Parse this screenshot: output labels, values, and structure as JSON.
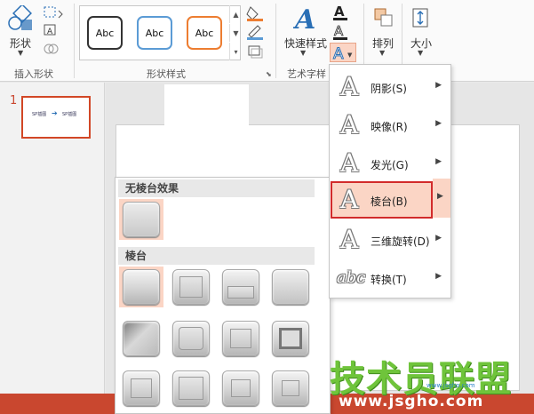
{
  "ribbon": {
    "insert_shapes": {
      "shape_label": "形状",
      "group_label": "插入形状"
    },
    "shape_styles": {
      "group_label": "形状样式",
      "styles": [
        "Abc",
        "Abc",
        "Abc"
      ]
    },
    "art_text": {
      "quick_styles_label": "快速样式",
      "group_label": "艺术字样"
    },
    "arrange": {
      "label": "排列"
    },
    "size": {
      "label": "大小"
    },
    "colors": {
      "black_border": "#333333",
      "blue_border": "#5b9bd5",
      "orange_border": "#ed7d31",
      "accent": "#d24726"
    }
  },
  "thumbnails": {
    "slide_number": "1",
    "slide_text_left": "SP插图",
    "slide_text_right": "SP插图"
  },
  "bevel_panel": {
    "no_bevel_header": "无棱台效果",
    "bevel_header": "棱台"
  },
  "effects_menu": {
    "items": [
      {
        "label": "阴影(S)",
        "icon": "text-effect-A-icon"
      },
      {
        "label": "映像(R)",
        "icon": "text-effect-A-icon"
      },
      {
        "label": "发光(G)",
        "icon": "text-effect-A-icon"
      },
      {
        "label": "棱台(B)",
        "icon": "text-effect-A-icon"
      },
      {
        "label": "三维旋转(D)",
        "icon": "text-effect-A-icon"
      },
      {
        "label": "转换(T)",
        "icon": "text-effect-abc-icon"
      }
    ]
  },
  "watermark": {
    "title": "技术员联盟",
    "url": "www.jsgho.com",
    "small": "www.jsgho.com"
  }
}
